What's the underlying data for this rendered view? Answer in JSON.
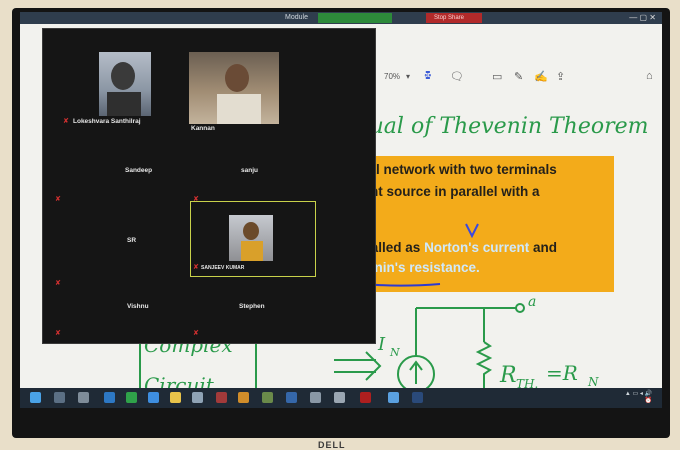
{
  "window": {
    "module_label": "Module",
    "red_tab_label": "Stop Share"
  },
  "toolbar": {
    "zoom_level": "70%",
    "tools": [
      "zoom-in-icon",
      "zoom-select",
      "select-tool-icon",
      "comment-icon",
      "note-icon",
      "pen-icon",
      "signature-icon",
      "share-icon"
    ]
  },
  "slide": {
    "handwritten_heading": "Dual of Thevenin Theorem",
    "lines": [
      "rical network with two terminals",
      "rrent source in parallel with a"
    ],
    "line3_prefix": "e called as ",
    "line3_highlight": "Norton's current",
    "line3_suffix": " and",
    "line4_highlight": "evenin's resistance."
  },
  "circuit": {
    "block_label_1": "Complex",
    "block_label_2": "Circuit",
    "current_label": "I",
    "current_sub": "N",
    "terminal_label": "a",
    "resistor_label": "R",
    "resistor_sub": "TH.",
    "equals_label": "=R",
    "equals_sub": "N"
  },
  "participants": [
    {
      "name": "Lokeshvara Santhilraj",
      "video": true
    },
    {
      "name": "Kannan",
      "video": true
    },
    {
      "name": "Sandeep",
      "video": false
    },
    {
      "name": "sanju",
      "video": false
    },
    {
      "name": "SR",
      "video": false
    },
    {
      "name": "SANJEEV KUMAR",
      "video": true
    },
    {
      "name": "Vishnu",
      "video": false
    },
    {
      "name": "Stephen",
      "video": false
    }
  ],
  "monitor_brand": "DELL"
}
